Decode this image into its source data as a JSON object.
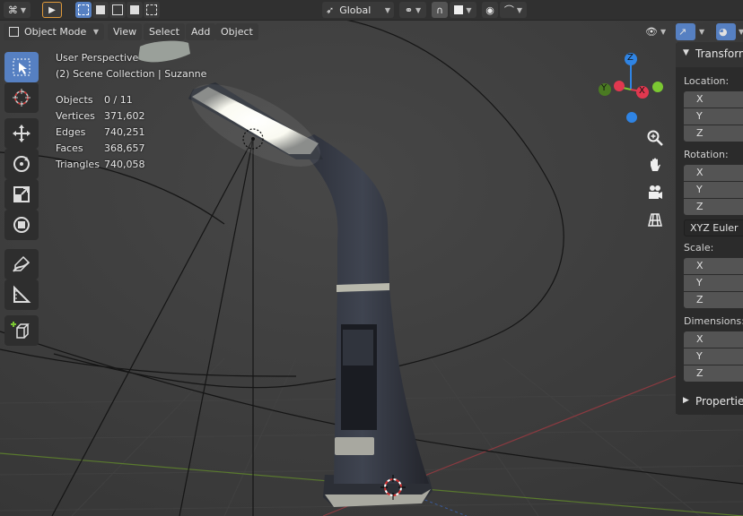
{
  "header": {
    "transform_orientation": "Global"
  },
  "menu": {
    "mode": "Object Mode",
    "view": "View",
    "select": "Select",
    "add": "Add",
    "object": "Object"
  },
  "overlay": {
    "perspective": "User Perspective",
    "collection": "(2) Scene Collection | Suzanne",
    "stats": [
      {
        "label": "Objects",
        "value": "0 / 11"
      },
      {
        "label": "Vertices",
        "value": "371,602"
      },
      {
        "label": "Edges",
        "value": "740,251"
      },
      {
        "label": "Faces",
        "value": "368,657"
      },
      {
        "label": "Triangles",
        "value": "740,058"
      }
    ]
  },
  "gizmo": {
    "z_label": "Z",
    "y_label": "Y",
    "x_label": "X",
    "colors": {
      "x": "#e0384f",
      "y": "#7bc832",
      "z": "#2f84e4"
    }
  },
  "npanel": {
    "title": "Transform",
    "location_label": "Location:",
    "rotation_label": "Rotation:",
    "rotation_mode": "XYZ Euler",
    "scale_label": "Scale:",
    "dimensions_label": "Dimensions:",
    "axes": [
      "X",
      "Y",
      "Z"
    ],
    "properties_label": "Properties"
  },
  "colors": {
    "accent": "#5680c2",
    "background": "#3d3d3d"
  }
}
